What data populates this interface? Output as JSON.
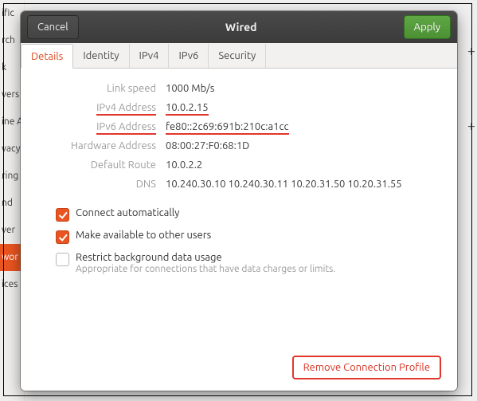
{
  "window": {
    "title": "Wired",
    "cancel_label": "Cancel",
    "apply_label": "Apply"
  },
  "tabs": [
    {
      "label": "Details"
    },
    {
      "label": "Identity"
    },
    {
      "label": "IPv4"
    },
    {
      "label": "IPv6"
    },
    {
      "label": "Security"
    }
  ],
  "details": {
    "link_speed": {
      "label": "Link speed",
      "value": "1000 Mb/s"
    },
    "ipv4": {
      "label": "IPv4 Address",
      "value": "10.0.2.15"
    },
    "ipv6": {
      "label": "IPv6 Address",
      "value": "fe80::2c69:691b:210c:a1cc"
    },
    "hw": {
      "label": "Hardware Address",
      "value": "08:00:27:F0:68:1D"
    },
    "route": {
      "label": "Default Route",
      "value": "10.0.2.2"
    },
    "dns": {
      "label": "DNS",
      "value": "10.240.30.10 10.240.30.11 10.20.31.50 10.20.31.55"
    }
  },
  "checks": {
    "auto": {
      "label": "Connect automatically",
      "checked": true
    },
    "shared": {
      "label": "Make available to other users",
      "checked": true
    },
    "restrict": {
      "label": "Restrict background data usage",
      "sub": "Appropriate for connections that have data charges or limits.",
      "checked": false
    }
  },
  "footer": {
    "remove_label": "Remove Connection Profile"
  },
  "bg_items": [
    "ific",
    "rch",
    "k",
    "vers",
    "ine A",
    "vacy",
    "ring",
    "nd",
    "ver",
    "wor",
    "ices"
  ],
  "bg_selected_index": 9,
  "plus_positions": [
    54,
    148
  ]
}
